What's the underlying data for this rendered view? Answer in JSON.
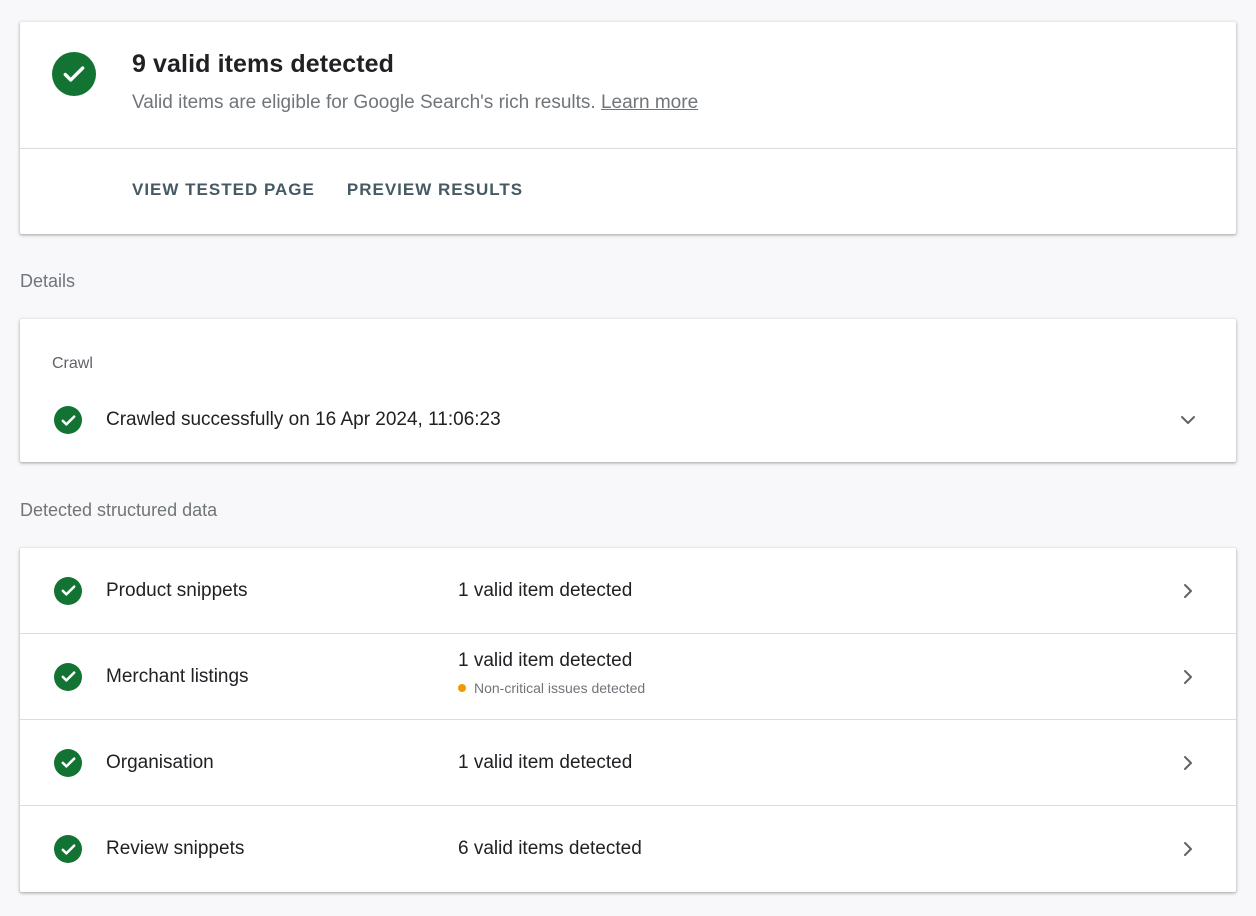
{
  "summary": {
    "title": "9 valid items detected",
    "subtitle": "Valid items are eligible for Google Search's rich results.",
    "learn_more": "Learn more",
    "actions": [
      "VIEW TESTED PAGE",
      "PREVIEW RESULTS"
    ],
    "status_icon": "check-circle-icon"
  },
  "details_label": "Details",
  "crawl": {
    "heading": "Crawl",
    "status_text": "Crawled successfully on 16 Apr 2024, 11:06:23",
    "status_icon": "check-circle-icon",
    "expand_icon": "chevron-down-icon"
  },
  "structured_label": "Detected structured data",
  "structured_items": [
    {
      "name": "Product snippets",
      "count": "1 valid item detected",
      "issue": ""
    },
    {
      "name": "Merchant listings",
      "count": "1 valid item detected",
      "issue": "Non-critical issues detected"
    },
    {
      "name": "Organisation",
      "count": "1 valid item detected",
      "issue": ""
    },
    {
      "name": "Review snippets",
      "count": "6 valid items detected",
      "issue": ""
    }
  ],
  "colors": {
    "success": "#137333",
    "warning": "#f29900",
    "action_text": "#455a64"
  }
}
